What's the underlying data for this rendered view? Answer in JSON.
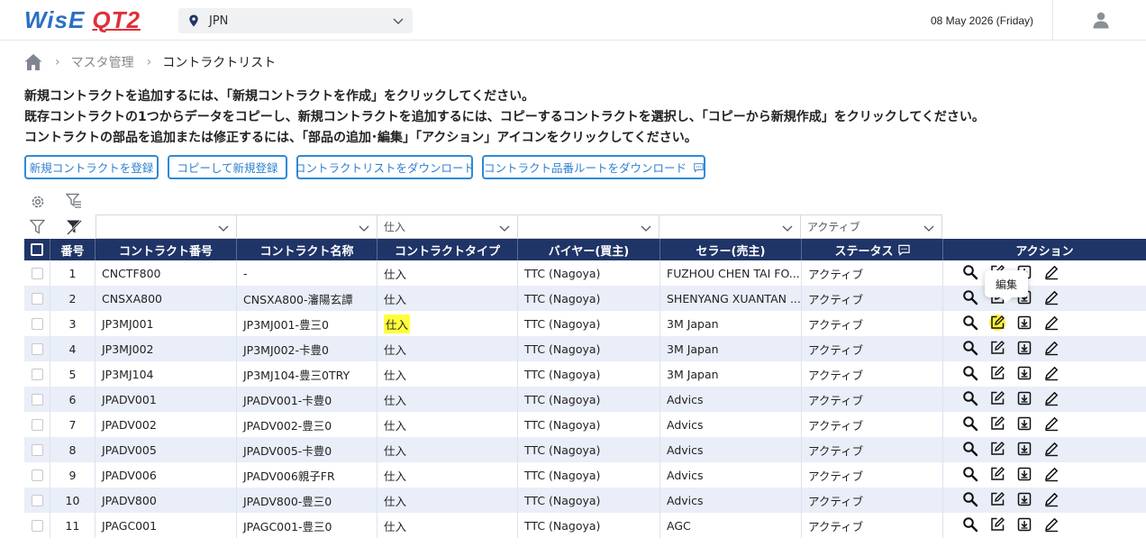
{
  "header": {
    "logo_part1": "WisE",
    "logo_part2": "QT2",
    "region": "JPN",
    "date": "08 May 2026 (Friday)"
  },
  "breadcrumb": {
    "level1": "マスタ管理",
    "current": "コントラクトリスト"
  },
  "instructions": [
    "新規コントラクトを追加するには、「新規コントラクトを作成」をクリックしてください。",
    "既存コントラクトの1つからデータをコピーし、新規コントラクトを追加するには、コピーするコントラクトを選択し、「コピーから新規作成」をクリックしてください。",
    "コントラクトの部品を追加または修正するには、「部品の追加･編集」「アクション」アイコンをクリックしてください。"
  ],
  "buttons": {
    "register": "新規コントラクトを登録",
    "copy_register": "コピーして新規登録",
    "download_list": "コントラクトリストをダウンロード",
    "download_parts": "コントラクト品番ルートをダウンロード"
  },
  "filters": {
    "contract_no": "",
    "contract_name": "",
    "contract_type": "仕入",
    "buyer": "",
    "seller": "",
    "status": "アクティブ"
  },
  "columns": {
    "no": "番号",
    "contract_no": "コントラクト番号",
    "contract_name": "コントラクト名称",
    "contract_type": "コントラクトタイプ",
    "buyer": "バイヤー(買主)",
    "seller": "セラー(売主)",
    "status": "ステータス",
    "action": "アクション"
  },
  "tooltip": "編集",
  "rows": [
    {
      "no": "1",
      "contract_no": "CNCTF800",
      "contract_name": "-",
      "type": "仕入",
      "buyer": "TTC (Nagoya)",
      "seller": "FUZHOU CHEN TAI FO...",
      "status": "アクティブ"
    },
    {
      "no": "2",
      "contract_no": "CNSXA800",
      "contract_name": "CNSXA800-瀋陽玄譚",
      "type": "仕入",
      "buyer": "TTC (Nagoya)",
      "seller": "SHENYANG XUANTAN ...",
      "status": "アクティブ"
    },
    {
      "no": "3",
      "contract_no": "JP3MJ001",
      "contract_name": "JP3MJ001-豊三0",
      "type": "仕入",
      "buyer": "TTC (Nagoya)",
      "seller": "3M Japan",
      "status": "アクティブ"
    },
    {
      "no": "4",
      "contract_no": "JP3MJ002",
      "contract_name": "JP3MJ002-卡豊0",
      "type": "仕入",
      "buyer": "TTC (Nagoya)",
      "seller": "3M Japan",
      "status": "アクティブ"
    },
    {
      "no": "5",
      "contract_no": "JP3MJ104",
      "contract_name": "JP3MJ104-豊三0TRY",
      "type": "仕入",
      "buyer": "TTC (Nagoya)",
      "seller": "3M Japan",
      "status": "アクティブ"
    },
    {
      "no": "6",
      "contract_no": "JPADV001",
      "contract_name": "JPADV001-卡豊0",
      "type": "仕入",
      "buyer": "TTC (Nagoya)",
      "seller": "Advics",
      "status": "アクティブ"
    },
    {
      "no": "7",
      "contract_no": "JPADV002",
      "contract_name": "JPADV002-豊三0",
      "type": "仕入",
      "buyer": "TTC (Nagoya)",
      "seller": "Advics",
      "status": "アクティブ"
    },
    {
      "no": "8",
      "contract_no": "JPADV005",
      "contract_name": "JPADV005-卡豊0",
      "type": "仕入",
      "buyer": "TTC (Nagoya)",
      "seller": "Advics",
      "status": "アクティブ"
    },
    {
      "no": "9",
      "contract_no": "JPADV006",
      "contract_name": "JPADV006親子FR",
      "type": "仕入",
      "buyer": "TTC (Nagoya)",
      "seller": "Advics",
      "status": "アクティブ"
    },
    {
      "no": "10",
      "contract_no": "JPADV800",
      "contract_name": "JPADV800-豊三0",
      "type": "仕入",
      "buyer": "TTC (Nagoya)",
      "seller": "Advics",
      "status": "アクティブ"
    },
    {
      "no": "11",
      "contract_no": "JPAGC001",
      "contract_name": "JPAGC001-豊三0",
      "type": "仕入",
      "buyer": "TTC (Nagoya)",
      "seller": "AGC",
      "status": "アクティブ"
    }
  ]
}
